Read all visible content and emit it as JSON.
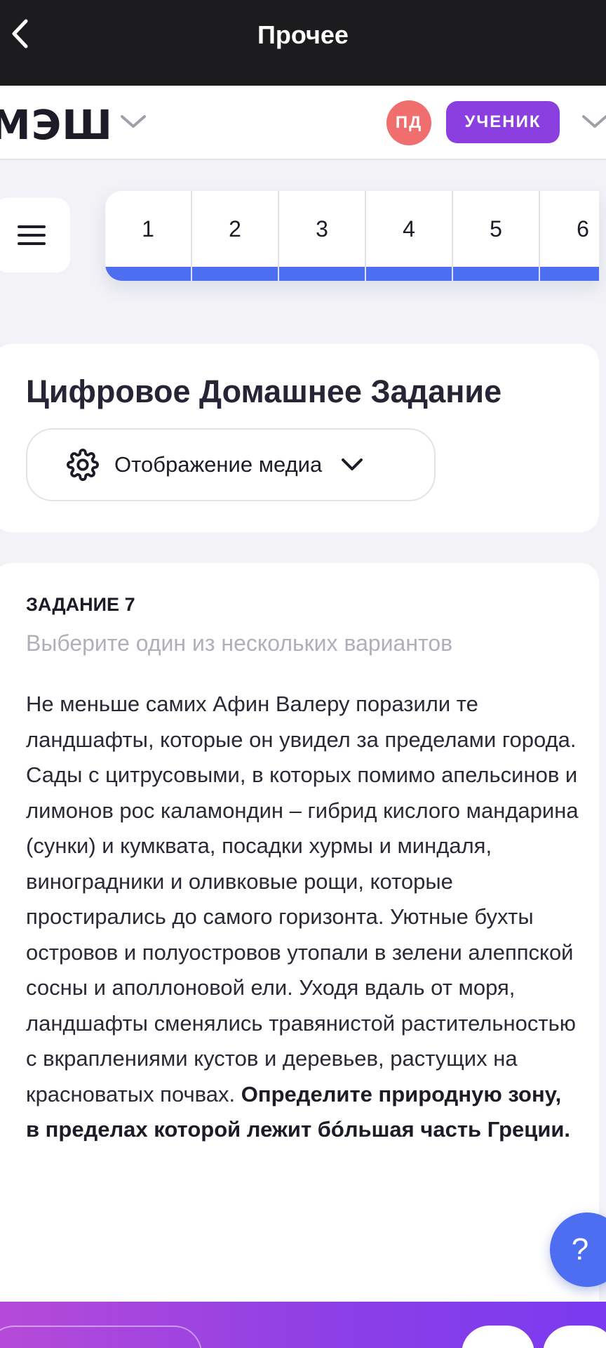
{
  "topbar": {
    "title": "Прочее",
    "back_icon": "chevron-left-icon"
  },
  "header": {
    "logo": "МЭШ",
    "avatar_initials": "ПД",
    "role_label": "УЧЕНИК",
    "colors": {
      "avatar": "#f06e6e",
      "role": "#8c3fe0"
    }
  },
  "task_nav": {
    "items": [
      "1",
      "2",
      "3",
      "4",
      "5",
      "6"
    ],
    "accent": "#4e6ef2"
  },
  "card": {
    "title": "Цифровое Домашнее Задание",
    "media_select_label": "Отображение медиа"
  },
  "task": {
    "number_label": "ЗАДАНИЕ 7",
    "hint": "Выберите один из нескольких вариантов",
    "text": "Не меньше самих Афин Валеру поразили те ландшафты, которые он увидел за пределами города. Сады с цитрусовыми, в которых помимо апельсинов и лимонов рос каламондин – гибрид кислого мандарина (сунки) и кумквата, посадки хурмы и миндаля, виноградники и оливковые рощи, которые простирались до самого горизонта. Уютные бухты островов и полуостровов утопали в зелени алеппской сосны и аполлоновой ели. Уходя вдаль от моря, ландшафты сменялись травянистой растительностью с вкраплениями кустов и деревьев, растущих на красноватых почвах.",
    "question": "Определите природную зону, в пределах которой лежит бóльшая часть Греции."
  },
  "help": {
    "label": "?"
  }
}
